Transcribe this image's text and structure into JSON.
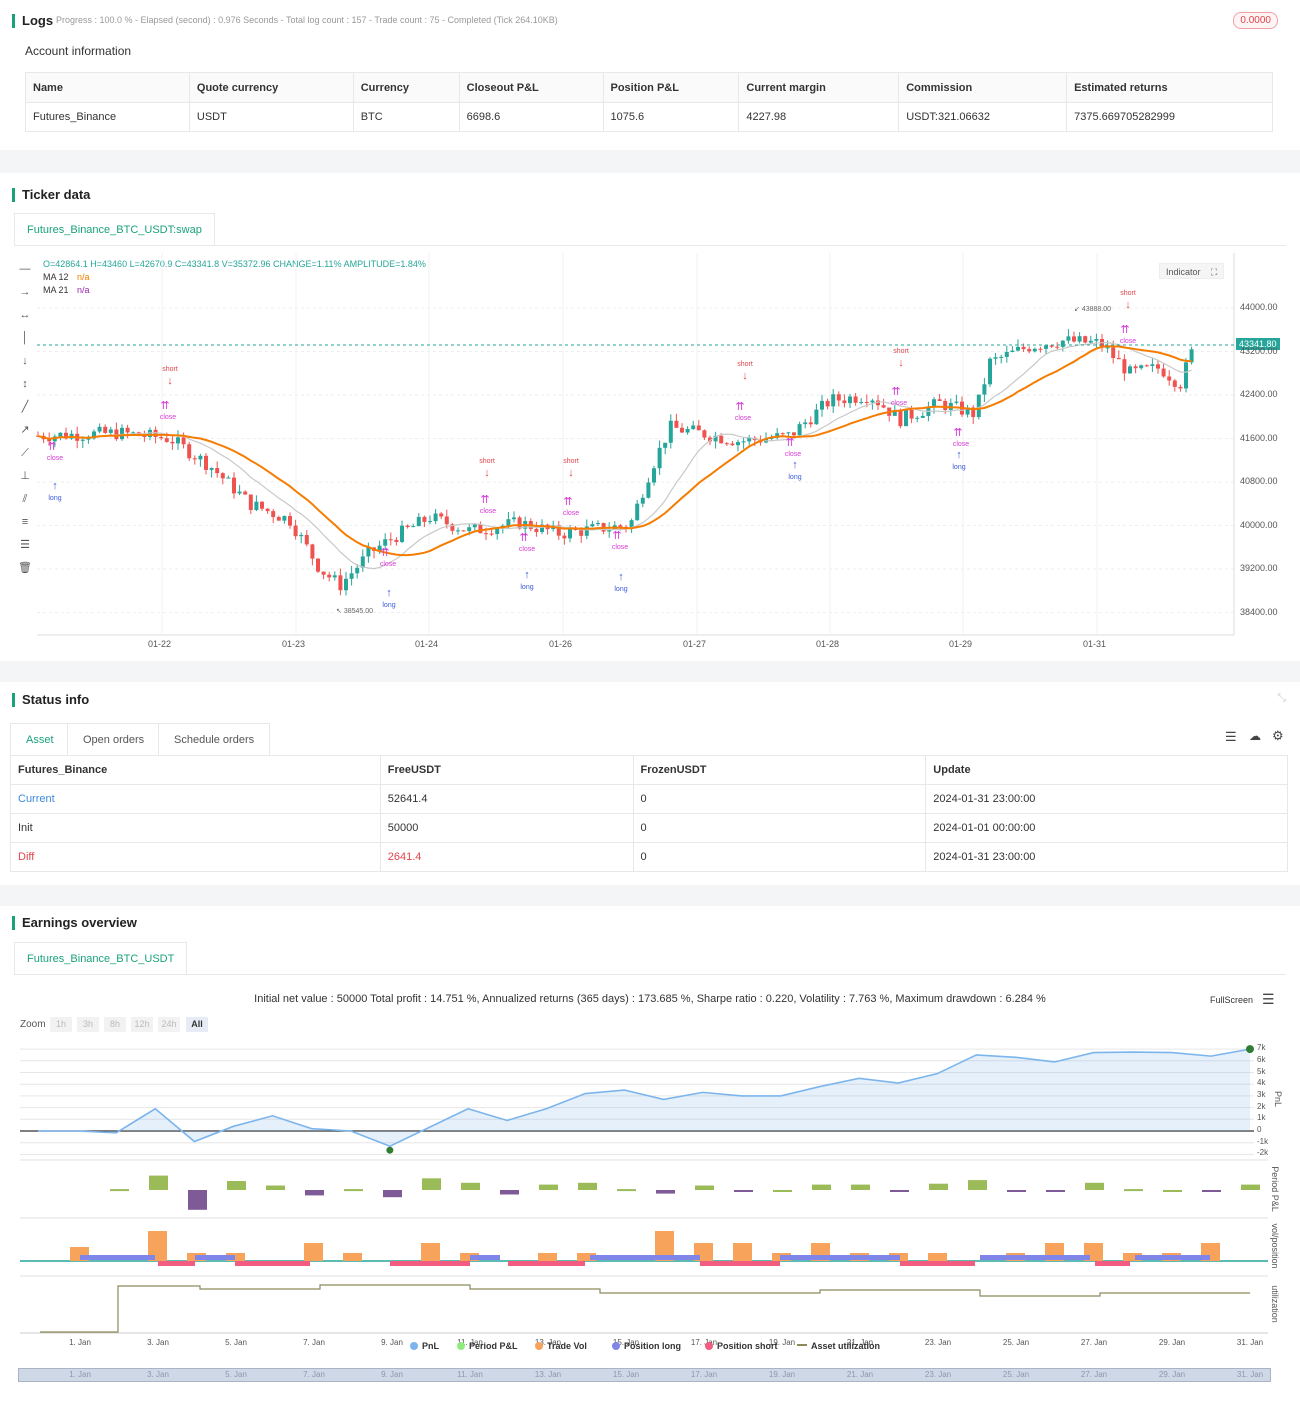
{
  "logs": {
    "title": "Logs",
    "status": "Progress : 100.0 % - Elapsed (second) : 0.976  Seconds - Total log count : 157 - Trade count : 75 - Completed (Tick 264.10KB)",
    "badge": "0.0000"
  },
  "account": {
    "title": "Account information",
    "headers": [
      "Name",
      "Quote currency",
      "Currency",
      "Closeout P&L",
      "Position P&L",
      "Current margin",
      "Commission",
      "Estimated returns"
    ],
    "row": [
      "Futures_Binance",
      "USDT",
      "BTC",
      "6698.6",
      "1075.6",
      "4227.98",
      "USDT:321.06632",
      "7375.669705282999"
    ]
  },
  "ticker": {
    "title": "Ticker data",
    "tab": "Futures_Binance_BTC_USDT:swap",
    "ohlc": "O=42864.1 H=43460 L=42670.9 C=43341.8 V=35372.96 CHANGE=1.11% AMPLITUDE=1.84%",
    "ma12_label": "MA 12",
    "ma12_value": "n/a",
    "ma21_label": "MA 21",
    "ma21_value": "n/a",
    "indicator_btn": "Indicator",
    "last_price": "43341.80",
    "high_marker": "43888.00",
    "low_marker": "38545.00",
    "y_ticks": [
      "44000.00",
      "43200.00",
      "42400.00",
      "41600.00",
      "40800.00",
      "40000.00",
      "39200.00",
      "38400.00"
    ],
    "x_ticks": [
      "01-22",
      "01-23",
      "01-24",
      "01-26",
      "01-27",
      "01-28",
      "01-29",
      "01-31"
    ]
  },
  "status": {
    "title": "Status info",
    "tabs": [
      "Asset",
      "Open orders",
      "Schedule orders"
    ],
    "headers": [
      "Futures_Binance",
      "FreeUSDT",
      "FrozenUSDT",
      "Update"
    ],
    "rows": [
      [
        "Current",
        "52641.4",
        "0",
        "2024-01-31 23:00:00"
      ],
      [
        "Init",
        "50000",
        "0",
        "2024-01-01 00:00:00"
      ],
      [
        "Diff",
        "2641.4",
        "0",
        "2024-01-31 23:00:00"
      ]
    ]
  },
  "earnings": {
    "title": "Earnings overview",
    "tab": "Futures_Binance_BTC_USDT",
    "summary": "Initial net value : 50000  Total profit : 14.751 %, Annualized returns (365 days) : 173.685 %, Sharpe ratio : 0.220, Volatility : 7.763 %, Maximum drawdown : 6.284 %",
    "fullscreen": "FullScreen",
    "zoom_label": "Zoom",
    "zoom_opts": [
      "1h",
      "3h",
      "8h",
      "12h",
      "24h",
      "All"
    ],
    "pnl_ticks": [
      "7k",
      "6k",
      "5k",
      "4k",
      "3k",
      "2k",
      "1k",
      "0",
      "-1k",
      "-2k"
    ],
    "axis_titles": [
      "PnL",
      "Period P&L",
      "vol/position",
      "utilization"
    ],
    "period_tick": "-4k",
    "vol_tick": "-2.5",
    "util_tick": "0",
    "x_ticks": [
      "1. Jan",
      "3. Jan",
      "5. Jan",
      "7. Jan",
      "9. Jan",
      "11. Jan",
      "13. Jan",
      "15. Jan",
      "17. Jan",
      "19. Jan",
      "21. Jan",
      "23. Jan",
      "25. Jan",
      "27. Jan",
      "29. Jan",
      "31. Jan"
    ],
    "legend": [
      {
        "label": "PnL",
        "color": "#7cb5ec"
      },
      {
        "label": "Period P&L",
        "color": "#90ed7d"
      },
      {
        "label": "Trade Vol",
        "color": "#f7a35c"
      },
      {
        "label": "Position long",
        "color": "#8085e9"
      },
      {
        "label": "Position short",
        "color": "#f15c80"
      },
      {
        "label": "Asset utilization",
        "color": "#8d8a5a"
      }
    ]
  },
  "chart_data": {
    "type": "line",
    "title": "",
    "series": [
      {
        "name": "PnL",
        "values": [
          0,
          0,
          -150,
          1900,
          -900,
          400,
          1300,
          200,
          0,
          -1300,
          300,
          1900,
          900,
          1900,
          3200,
          3500,
          2700,
          3300,
          3000,
          3000,
          3800,
          4500,
          4100,
          4900,
          6500,
          6300,
          5900,
          6700,
          6750,
          6700,
          6400,
          7000
        ]
      }
    ],
    "ylim": [
      -2000,
      7000
    ]
  }
}
